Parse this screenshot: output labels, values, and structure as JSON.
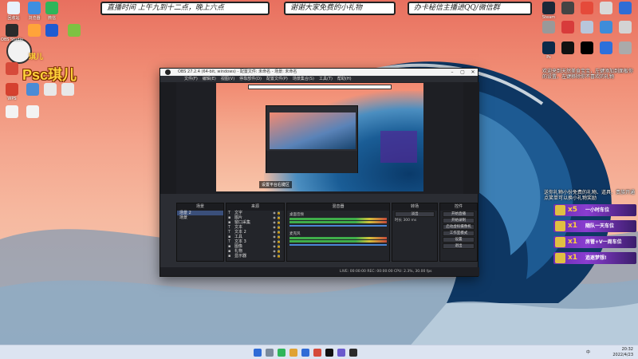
{
  "desktop": {
    "left_icons": [
      {
        "label": "回收站",
        "color": "#e8f1fb"
      },
      {
        "label": "浏览器",
        "color": "#3d8ee0"
      },
      {
        "label": "微信",
        "color": "#2fb55a"
      },
      {
        "label": "OBS Studio",
        "color": "#2b2b2b"
      },
      {
        "label": "",
        "color": "#ffa43a"
      },
      {
        "label": "",
        "color": "#1f5bd1"
      },
      {
        "label": "",
        "color": "#7ec242"
      },
      {
        "label": "",
        "color": "#d64a3a"
      },
      {
        "label": "WPS",
        "color": "#d5412f"
      },
      {
        "label": "",
        "color": "#4a8bd6"
      },
      {
        "label": "",
        "color": "#e8e8e8"
      },
      {
        "label": "",
        "color": "#e8e8e8"
      },
      {
        "label": "",
        "color": "#f3f3f3"
      },
      {
        "label": "",
        "color": "#f3f3f3"
      }
    ],
    "right_icons": [
      {
        "label": "Steam",
        "color": "#1b2838"
      },
      {
        "label": "",
        "color": "#444"
      },
      {
        "label": "",
        "color": "#e54a3a"
      },
      {
        "label": "",
        "color": "#d9d9d9"
      },
      {
        "label": "",
        "color": "#2f6dd6"
      },
      {
        "label": "",
        "color": "#999"
      },
      {
        "label": "",
        "color": "#d83b3b"
      },
      {
        "label": "",
        "color": "#b8c6db"
      },
      {
        "label": "",
        "color": "#3e8cd9"
      },
      {
        "label": "",
        "color": "#d3d3d3"
      },
      {
        "label": "Ps",
        "color": "#0b2a4a"
      },
      {
        "label": "",
        "color": "#111"
      },
      {
        "label": "",
        "color": "#000"
      },
      {
        "label": "",
        "color": "#2d70db"
      },
      {
        "label": "",
        "color": "#aaa"
      }
    ]
  },
  "banners": [
    "直播时间 上午九到十二点，晚上六点",
    "谢谢大家免费的小礼物",
    "办卡秘信主播进QQ/微信群"
  ],
  "streamer": {
    "name": "Psc琪儿",
    "small_label": "琪儿"
  },
  "obs": {
    "title": "OBS 27.2.4 (64-bit, windows) - 配置文件: 未命名 - 场景: 未命名",
    "menu": [
      "文件(F)",
      "编辑(E)",
      "视图(V)",
      "停靠部件(D)",
      "配置文件(P)",
      "场景集合(S)",
      "工具(T)",
      "帮助(H)"
    ],
    "preview_tooltip": "设置平台右键区",
    "docks": {
      "scenes_title": "场景",
      "sources_title": "来源",
      "mixer_title": "混音器",
      "transition_title": "转场",
      "controls_title": "控件"
    },
    "scenes": [
      "场景 2",
      "场景"
    ],
    "sources": [
      {
        "type": "T",
        "name": "文字"
      },
      {
        "type": "▪",
        "name": "图片"
      },
      {
        "type": "▪",
        "name": "窗口采集"
      },
      {
        "type": "T",
        "name": "文本"
      },
      {
        "type": "T",
        "name": "文本 2"
      },
      {
        "type": "▪",
        "name": "工具"
      },
      {
        "type": "T",
        "name": "文本 3"
      },
      {
        "type": "▪",
        "name": "图像"
      },
      {
        "type": "▪",
        "name": "礼物"
      },
      {
        "type": "▪",
        "name": "显示器"
      }
    ],
    "mixer_tracks": [
      {
        "label": "桌面音频"
      },
      {
        "label": "麦克风"
      }
    ],
    "controls": [
      "开始直播",
      "开始录制",
      "启动虚拟摄像机",
      "工作室模式",
      "设置",
      "退出"
    ],
    "transition_label": "转场动画",
    "transition_value": "淡出",
    "duration_label": "时长",
    "duration_value": "300 ms",
    "status": "LIVE: 00:00:00   REC: 00:00:00   CPU: 2.3%, 30.00 fps"
  },
  "overlay": {
    "top_note": "欢迎来到天然美食宝宝，左键添加到面板你的设置，左键移除你不喜欢的礼物",
    "gift_note": "送你礼物小份免费的礼物、道具、贵族开通点笑单可以换小礼物奖励",
    "gifts": [
      {
        "count": "x5",
        "label": "一小时车位"
      },
      {
        "count": "x1",
        "label": "随队一天车位"
      },
      {
        "count": "x1",
        "label": "房管+V一周车位"
      },
      {
        "count": "x1",
        "label": "追逐梦想!"
      }
    ]
  },
  "taskbar": {
    "sys_text": "中",
    "time": "20:32",
    "date": "2022/4/23"
  }
}
